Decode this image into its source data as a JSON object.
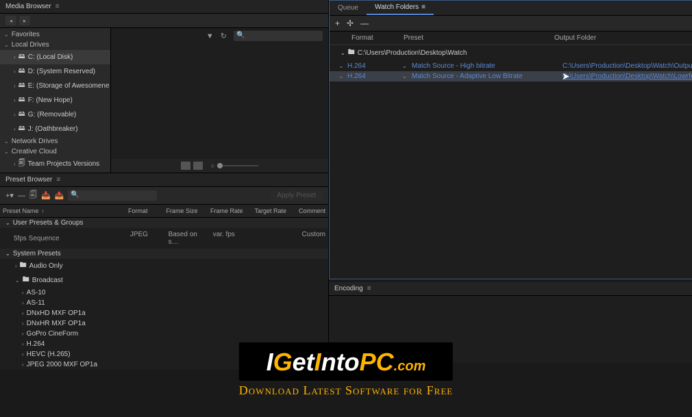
{
  "mediaBrowser": {
    "title": "Media Browser",
    "search_placeholder": "",
    "sections": {
      "favorites": "Favorites",
      "localDrives": "Local Drives",
      "networkDrives": "Network Drives",
      "creativeCloud": "Creative Cloud"
    },
    "drives": [
      "C: (Local Disk)",
      "D: (System Reserved)",
      "E: (Storage of Awesomene",
      "F: (New Hope)",
      "G: (Removable)",
      "J: (Oathbreaker)"
    ],
    "cc_item": "Team Projects Versions"
  },
  "presetBrowser": {
    "title": "Preset Browser",
    "apply_label": "Apply Preset",
    "columns": {
      "name": "Preset Name",
      "format": "Format",
      "frameSize": "Frame Size",
      "frameRate": "Frame Rate",
      "targetRate": "Target Rate",
      "comment": "Comment"
    },
    "groups": {
      "user": "User Presets & Groups",
      "system": "System Presets"
    },
    "userRow": {
      "name": "5fps Sequence",
      "format": "JPEG",
      "frameSize": "Based on s…",
      "frameRate": "var. fps",
      "targetRate": "",
      "comment": "Custom"
    },
    "systemItems": [
      "Audio Only",
      "Broadcast"
    ],
    "broadcastItems": [
      "AS-10",
      "AS-11",
      "DNxHD MXF OP1a",
      "DNxHR MXF OP1a",
      "GoPro CineForm",
      "H.264",
      "HEVC (H.265)",
      "JPEG 2000 MXF OP1a"
    ]
  },
  "rightPanel": {
    "tabs": {
      "queue": "Queue",
      "watchFolders": "Watch Folders"
    },
    "columns": {
      "format": "Format",
      "preset": "Preset",
      "output": "Output Folder"
    },
    "folder": "C:\\Users\\Production\\Desktop\\Watch",
    "rows": [
      {
        "format": "H.264",
        "preset": "Match Source - High bitrate",
        "output": "C:\\Users\\Production\\Desktop\\Watch\\Output\\"
      },
      {
        "format": "H.264",
        "preset": "Match Source - Adaptive Low Bitrate",
        "output": "C:\\Users\\Production\\Desktop\\Watch\\Lowrfes\\"
      }
    ]
  },
  "encoding": {
    "title": "Encoding"
  },
  "watermark": {
    "i": "I",
    "get": "G",
    "et": "et",
    "into": "I",
    "nto": "nto",
    "pc": "PC",
    "com": ".com",
    "sub": "Download Latest Software for Free"
  }
}
